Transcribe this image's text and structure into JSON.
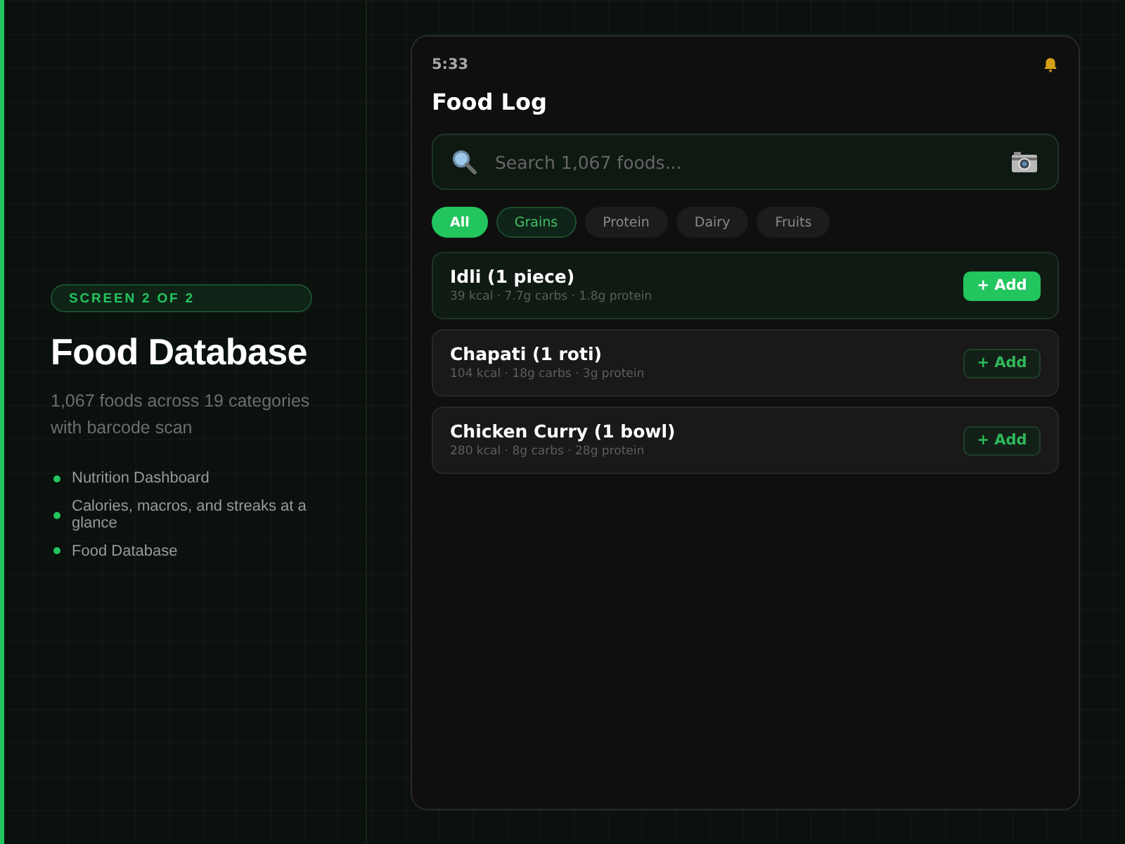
{
  "side_panel": {
    "badge": "SCREEN 2 OF 2",
    "title": "Food Database",
    "description": "1,067 foods across 19 categories with barcode scan",
    "features": [
      "Nutrition Dashboard",
      "Calories, macros, and streaks at a glance",
      "Food Database"
    ]
  },
  "phone": {
    "time": "5:33",
    "title": "Food Log",
    "search": {
      "placeholder": "Search 1,067 foods..."
    },
    "chips": [
      {
        "label": "All",
        "selected": true,
        "highlighted": false
      },
      {
        "label": "Grains",
        "selected": false,
        "highlighted": true
      },
      {
        "label": "Protein",
        "selected": false,
        "highlighted": false
      },
      {
        "label": "Dairy",
        "selected": false,
        "highlighted": false
      },
      {
        "label": "Fruits",
        "selected": false,
        "highlighted": false
      }
    ],
    "foods": [
      {
        "name": "Idli (1 piece)",
        "details": "39 kcal · 7.7g carbs · 1.8g protein",
        "button": "+ Add",
        "selected": true
      },
      {
        "name": "Chapati (1 roti)",
        "details": "104 kcal · 18g carbs · 3g protein",
        "button": "+ Add",
        "selected": false
      },
      {
        "name": "Chicken Curry (1 bowl)",
        "details": "280 kcal · 8g carbs · 28g protein",
        "button": "+ Add",
        "selected": false
      }
    ]
  }
}
